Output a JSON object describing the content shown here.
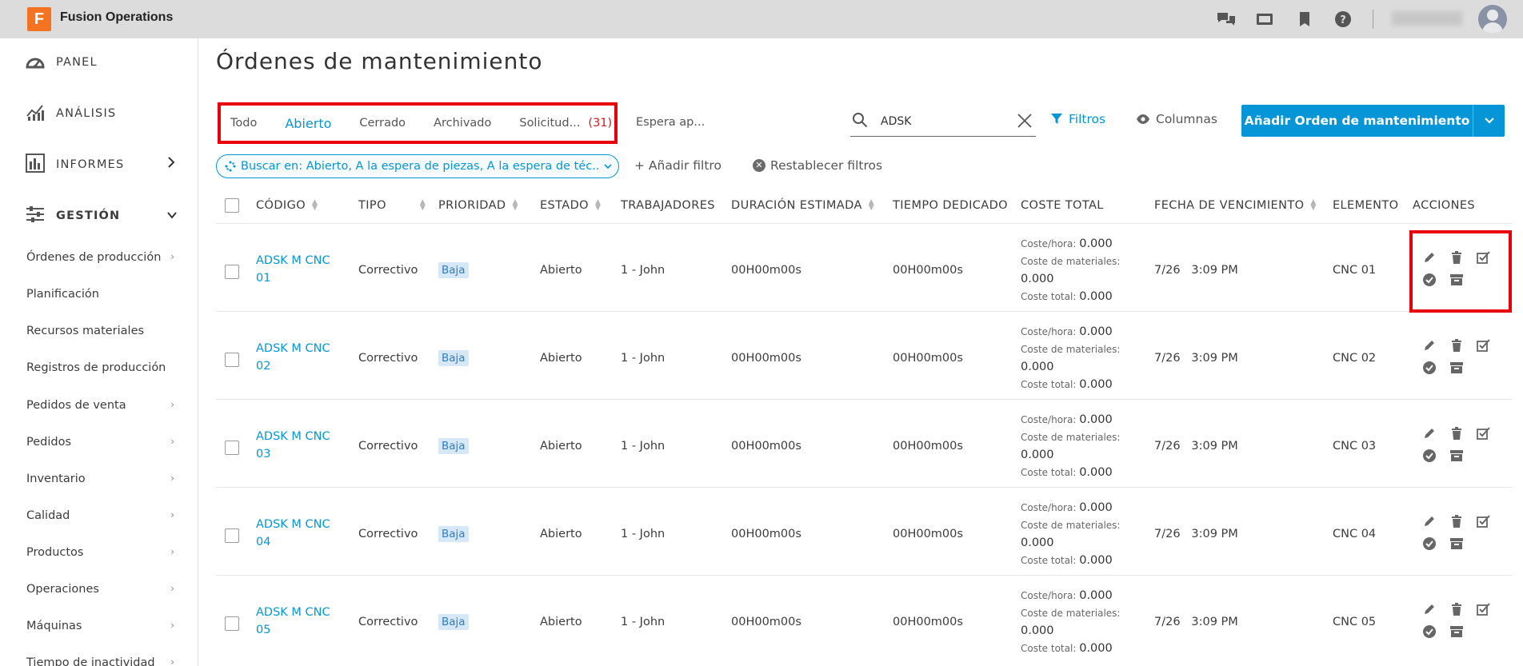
{
  "app": {
    "logo_letter": "F",
    "title": "Fusion Operations"
  },
  "topbar": {
    "icons": [
      "chat-icon",
      "screen-icon",
      "bookmark-icon",
      "help-icon"
    ],
    "user_name_blurred": ""
  },
  "sidebar": {
    "main_items": [
      {
        "label": "PANEL",
        "icon": "dashboard-icon"
      },
      {
        "label": "ANÁLISIS",
        "icon": "analytics-icon"
      },
      {
        "label": "INFORMES",
        "icon": "reports-icon"
      },
      {
        "label": "GESTIÓN",
        "icon": "management-icon"
      }
    ],
    "sub_items": [
      {
        "label": "Órdenes de producción",
        "arrow": "›"
      },
      {
        "label": "Planificación",
        "arrow": ""
      },
      {
        "label": "Recursos materiales",
        "arrow": ""
      },
      {
        "label": "Registros de producción",
        "arrow": ""
      },
      {
        "label": "Pedidos de venta",
        "arrow": "›"
      },
      {
        "label": "Pedidos",
        "arrow": "›"
      },
      {
        "label": "Inventario",
        "arrow": "›"
      },
      {
        "label": "Calidad",
        "arrow": "›"
      },
      {
        "label": "Productos",
        "arrow": "›"
      },
      {
        "label": "Operaciones",
        "arrow": "›"
      },
      {
        "label": "Máquinas",
        "arrow": "›"
      },
      {
        "label": "Tiempo de inactividad",
        "arrow": "›"
      }
    ]
  },
  "page": {
    "title": "Órdenes de mantenimiento"
  },
  "tabs": [
    {
      "label": "Todo"
    },
    {
      "label": "Abierto"
    },
    {
      "label": "Cerrado"
    },
    {
      "label": "Archivado"
    },
    {
      "label": "Solicitud...",
      "count": "(31)"
    }
  ],
  "tab_more": "Espera ap...",
  "search": {
    "value": "ADSK",
    "placeholder": ""
  },
  "toolbar": {
    "filters_label": "Filtros",
    "columns_label": "Columnas",
    "add_label": "Añadir Orden de mantenimiento"
  },
  "filter_bar": {
    "chip_text": "Buscar en: Abierto, A la espera de piezas, A la espera de téc...",
    "add_filter": "+ Añadir filtro",
    "reset_filters": "Restablecer filtros"
  },
  "table": {
    "columns": [
      "CÓDIGO",
      "TIPO",
      "PRIORIDAD",
      "ESTADO",
      "TRABAJADORES",
      "DURACIÓN ESTIMADA",
      "TIEMPO DEDICADO",
      "COSTE TOTAL",
      "FECHA DE VENCIMIENTO",
      "ELEMENTO",
      "ACCIONES"
    ],
    "cost_labels": {
      "hour": "Coste/hora:",
      "materials": "Coste de materiales:",
      "total": "Coste total:"
    },
    "rows": [
      {
        "code_1": "ADSK M CNC",
        "code_2": "01",
        "type": "Correctivo",
        "priority": "Baja",
        "status": "Abierto",
        "workers": "1 - John",
        "est_duration": "00H00m00s",
        "time_spent": "00H00m00s",
        "cost_hour": "0.000",
        "cost_materials": "0.000",
        "cost_total": "0.000",
        "due_date": "7/26",
        "due_time": "3:09 PM",
        "element": "CNC 01"
      },
      {
        "code_1": "ADSK M CNC",
        "code_2": "02",
        "type": "Correctivo",
        "priority": "Baja",
        "status": "Abierto",
        "workers": "1 - John",
        "est_duration": "00H00m00s",
        "time_spent": "00H00m00s",
        "cost_hour": "0.000",
        "cost_materials": "0.000",
        "cost_total": "0.000",
        "due_date": "7/26",
        "due_time": "3:09 PM",
        "element": "CNC 02"
      },
      {
        "code_1": "ADSK M CNC",
        "code_2": "03",
        "type": "Correctivo",
        "priority": "Baja",
        "status": "Abierto",
        "workers": "1 - John",
        "est_duration": "00H00m00s",
        "time_spent": "00H00m00s",
        "cost_hour": "0.000",
        "cost_materials": "0.000",
        "cost_total": "0.000",
        "due_date": "7/26",
        "due_time": "3:09 PM",
        "element": "CNC 03"
      },
      {
        "code_1": "ADSK M CNC",
        "code_2": "04",
        "type": "Correctivo",
        "priority": "Baja",
        "status": "Abierto",
        "workers": "1 - John",
        "est_duration": "00H00m00s",
        "time_spent": "00H00m00s",
        "cost_hour": "0.000",
        "cost_materials": "0.000",
        "cost_total": "0.000",
        "due_date": "7/26",
        "due_time": "3:09 PM",
        "element": "CNC 04"
      },
      {
        "code_1": "ADSK M CNC",
        "code_2": "05",
        "type": "Correctivo",
        "priority": "Baja",
        "status": "Abierto",
        "workers": "1 - John",
        "est_duration": "00H00m00s",
        "time_spent": "00H00m00s",
        "cost_hour": "0.000",
        "cost_materials": "0.000",
        "cost_total": "0.000",
        "due_date": "7/26",
        "due_time": "3:09 PM",
        "element": "CNC 05"
      }
    ],
    "action_icons": [
      "edit-icon",
      "delete-icon",
      "complete-checklist-icon",
      "approve-icon",
      "archive-icon"
    ]
  },
  "colors": {
    "accent": "#0696d7",
    "highlight": "#e8000d",
    "topbar": "#dcdcdc",
    "brand": "#f37321"
  }
}
